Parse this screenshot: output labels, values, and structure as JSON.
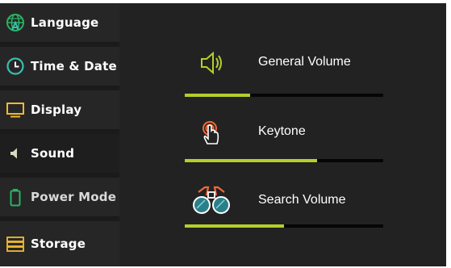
{
  "sidebar": {
    "items": [
      {
        "label": "Language",
        "icon": "globe-icon",
        "active": false
      },
      {
        "label": "Time & Date",
        "icon": "clock-icon",
        "active": false
      },
      {
        "label": "Display",
        "icon": "monitor-icon",
        "active": false
      },
      {
        "label": "Sound",
        "icon": "speaker-icon",
        "active": true
      },
      {
        "label": "Power Mode",
        "icon": "battery-icon",
        "active": false
      },
      {
        "label": "Storage",
        "icon": "storage-icon",
        "active": false
      }
    ]
  },
  "main": {
    "settings": [
      {
        "label": "General Volume",
        "icon": "speaker-volume-icon",
        "level": 0.33
      },
      {
        "label": "Keytone",
        "icon": "touch-hand-icon",
        "level": 0.665
      },
      {
        "label": "Search Volume",
        "icon": "binoculars-icon",
        "level": 0.5
      }
    ]
  },
  "colors": {
    "accent": "#b3cf2c",
    "panel": "#222222",
    "sidebar_item": "#262626",
    "icon_green": "#29b365",
    "icon_teal": "#37bfb0",
    "icon_orange": "#ee6a3c",
    "icon_yellow": "#f0b92f",
    "bar_track": "#050505"
  }
}
